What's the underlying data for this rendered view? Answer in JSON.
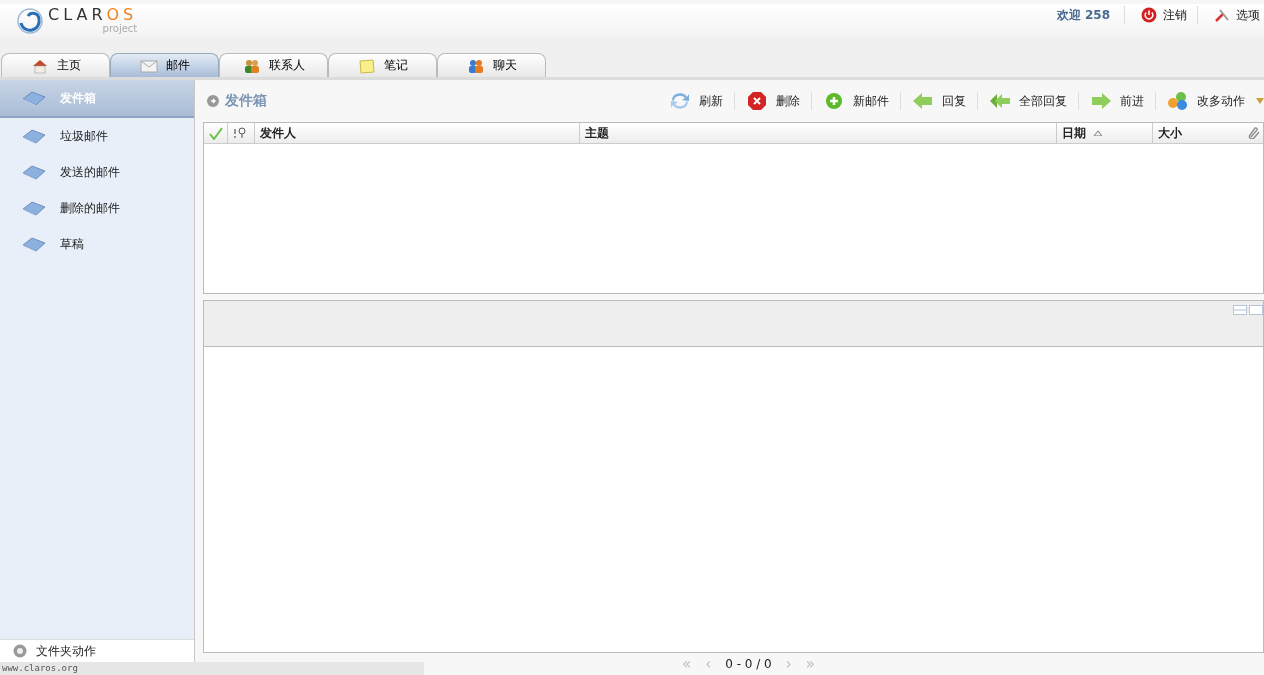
{
  "header": {
    "logo_main": "CLAR",
    "logo_accent": "OS",
    "logo_sub": "project",
    "welcome": "欢迎 258",
    "menu": [
      {
        "label": "注销",
        "kind": "logout"
      },
      {
        "label": "选项",
        "kind": "options"
      }
    ]
  },
  "tabs": [
    {
      "label": "主页",
      "kind": "home",
      "selected": false
    },
    {
      "label": "邮件",
      "kind": "mail",
      "selected": true
    },
    {
      "label": "联系人",
      "kind": "contacts",
      "selected": false
    },
    {
      "label": "笔记",
      "kind": "notes",
      "selected": false
    },
    {
      "label": "聊天",
      "kind": "chat",
      "selected": false
    }
  ],
  "sidebar": {
    "folders": [
      {
        "label": "发件箱",
        "selected": true
      },
      {
        "label": "垃圾邮件",
        "selected": false
      },
      {
        "label": "发送的邮件",
        "selected": false
      },
      {
        "label": "删除的邮件",
        "selected": false
      },
      {
        "label": "草稿",
        "selected": false
      }
    ],
    "folder_actions": "文件夹动作"
  },
  "content": {
    "title": "发件箱",
    "toolbar": [
      {
        "label": "刷新",
        "kind": "refresh"
      },
      {
        "label": "删除",
        "kind": "delete"
      },
      {
        "label": "新邮件",
        "kind": "new"
      },
      {
        "label": "回复",
        "kind": "reply"
      },
      {
        "label": "全部回复",
        "kind": "replyall"
      },
      {
        "label": "前进",
        "kind": "forward"
      },
      {
        "label": "改多动作",
        "kind": "more"
      }
    ],
    "columns": [
      {
        "kind": "check"
      },
      {
        "kind": "priority"
      },
      {
        "kind": "text",
        "label": "发件人"
      },
      {
        "kind": "text",
        "label": "主题"
      },
      {
        "kind": "sort",
        "label": "日期",
        "ascending": true
      },
      {
        "kind": "attach",
        "label": "大小"
      }
    ],
    "pager": {
      "first": "«",
      "prev": "‹",
      "text": "0 - 0 / 0",
      "next": "›",
      "last": "»"
    }
  },
  "status_bar": "www.claros.org"
}
